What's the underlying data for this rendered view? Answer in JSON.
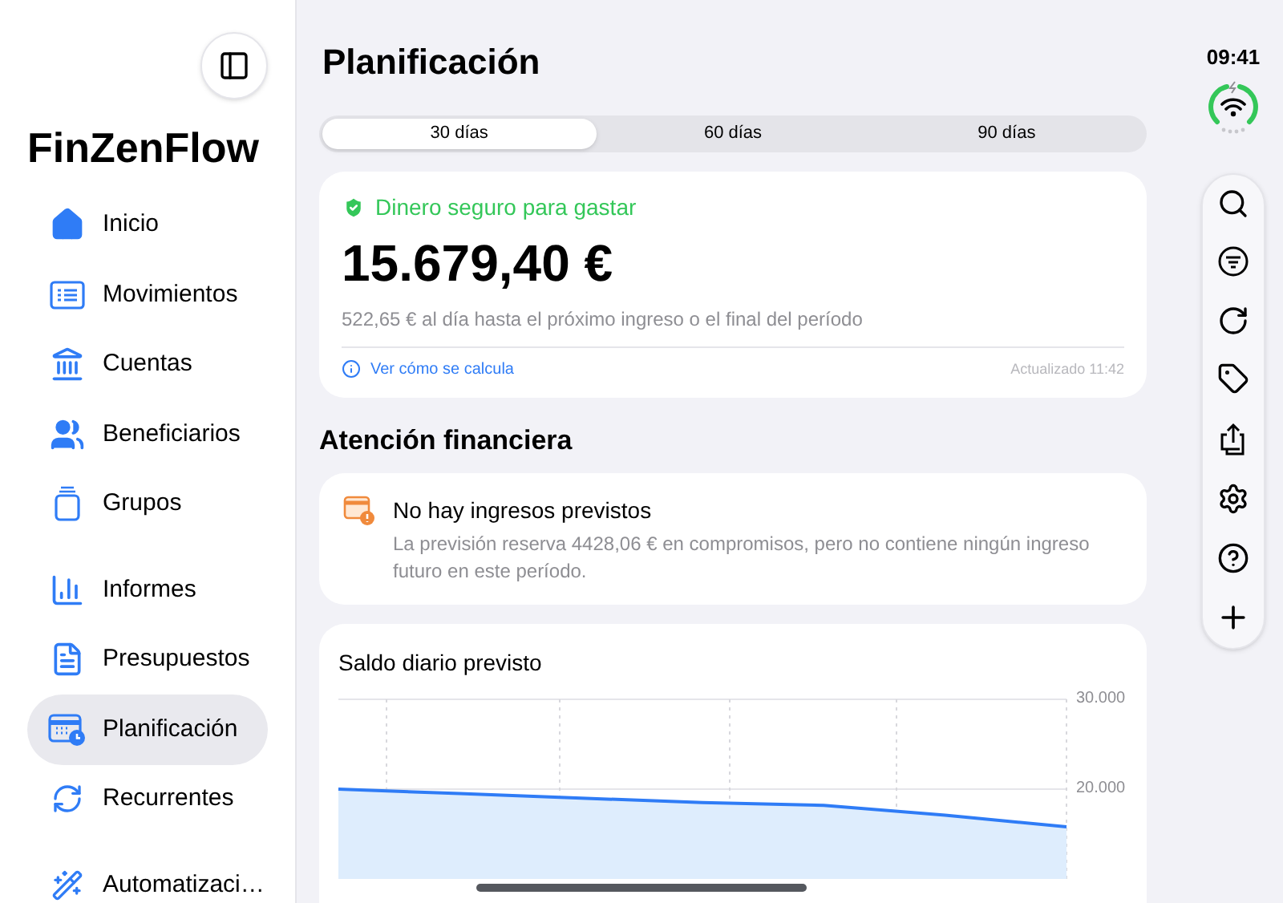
{
  "sidebar": {
    "app_title": "FinZenFlow",
    "sections": [
      {
        "items": [
          {
            "label": "Inicio",
            "selected": false
          },
          {
            "label": "Movimientos",
            "selected": false
          },
          {
            "label": "Cuentas",
            "selected": false
          },
          {
            "label": "Beneficiarios",
            "selected": false
          },
          {
            "label": "Grupos",
            "selected": false
          }
        ]
      },
      {
        "items": [
          {
            "label": "Informes",
            "selected": false
          },
          {
            "label": "Presupuestos",
            "selected": false
          },
          {
            "label": "Planificación",
            "selected": true
          },
          {
            "label": "Recurrentes",
            "selected": false
          }
        ]
      },
      {
        "items": [
          {
            "label": "Automatizaci…",
            "selected": false
          }
        ]
      }
    ]
  },
  "page_title": "Planificación",
  "tabs": [
    {
      "label": "30 días",
      "selected": true
    },
    {
      "label": "60 días",
      "selected": false
    },
    {
      "label": "90 días",
      "selected": false
    }
  ],
  "safe_card": {
    "heading": "Dinero seguro para gastar",
    "amount": "15.679,40 €",
    "subtitle": "522,65 € al día hasta el próximo ingreso o el final del período",
    "link": "Ver cómo se calcula",
    "updated": "Actualizado 11:42"
  },
  "section_title": "Atención financiera",
  "alert": {
    "title": "No hay ingresos previstos",
    "body": "La previsión reserva 4428,06 € en compromisos, pero no contiene ningún ingreso futuro en este período."
  },
  "chart_card": {
    "title": "Saldo diario previsto",
    "chart_data": {
      "type": "area",
      "categories": [
        null,
        null,
        null,
        null,
        null,
        null,
        null
      ],
      "series": [
        {
          "color": "#2f7cf6",
          "values": [
            20000,
            19500,
            19000,
            18500,
            18200,
            17100,
            15800
          ]
        }
      ],
      "ylim": [
        10000,
        30000
      ],
      "yticks": [
        {
          "value": 20000,
          "label": "20.000"
        },
        {
          "value": 30000,
          "label": "30.000"
        }
      ]
    }
  },
  "status": {
    "time": "09:41"
  }
}
